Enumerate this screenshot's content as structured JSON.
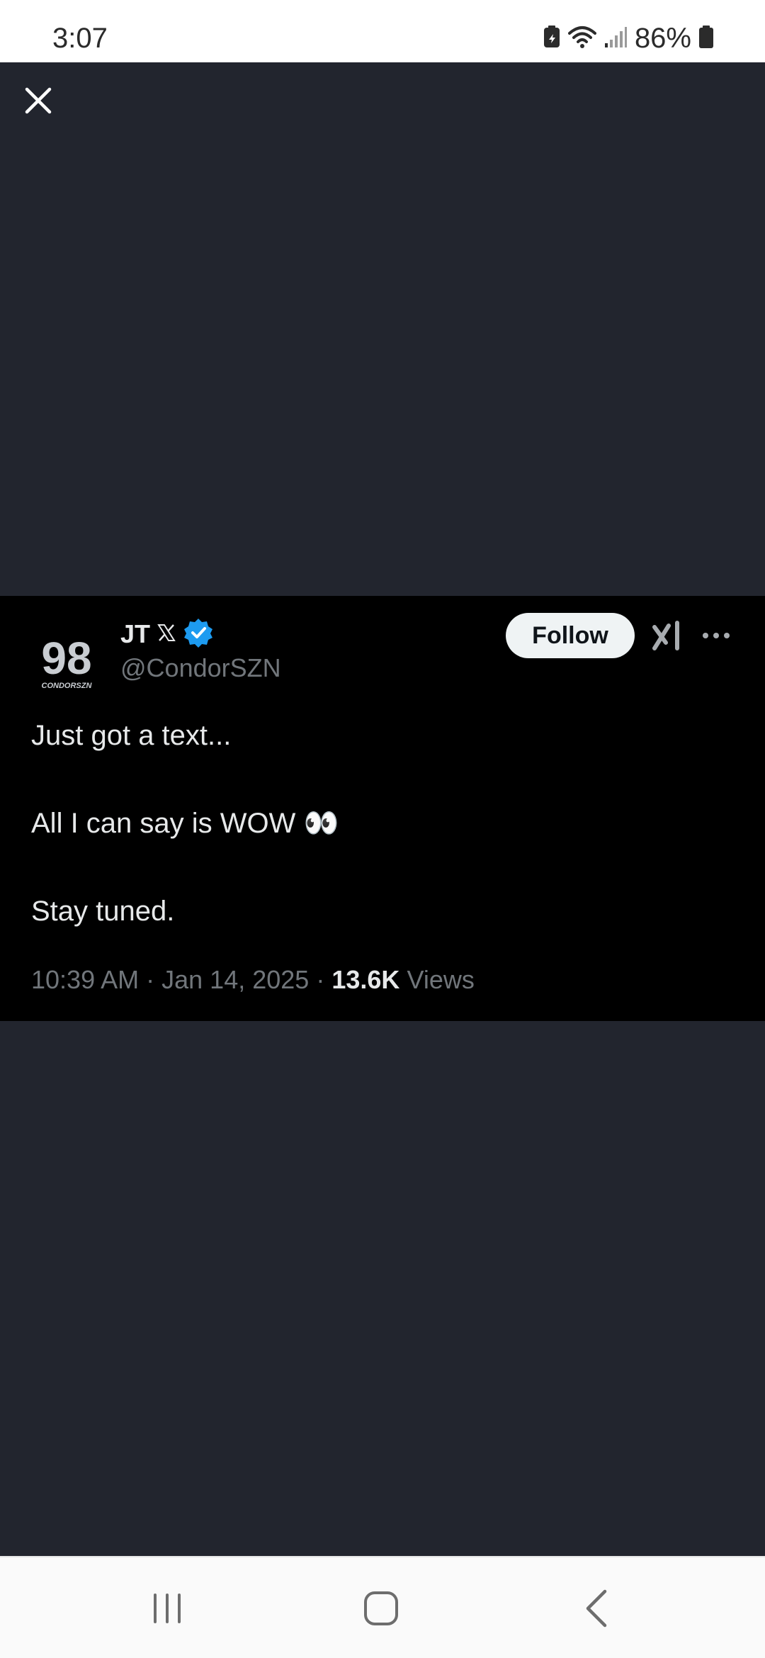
{
  "status_bar": {
    "time": "3:07",
    "battery_percent": "86%",
    "icons": [
      "battery-saver-icon",
      "wifi-icon",
      "cell-signal-icon",
      "battery-icon"
    ]
  },
  "viewer": {
    "close_icon": "close-icon"
  },
  "tweet": {
    "avatar_text": "98",
    "avatar_subtext": "CONDORSZN",
    "display_name": "JT",
    "name_badges": [
      "x-logo-icon",
      "verified-badge-icon"
    ],
    "handle": "@CondorSZN",
    "follow_label": "Follow",
    "grok_icon": "grok-icon",
    "more_icon": "more-options-icon",
    "text_lines": [
      "Just got a text...",
      "",
      "All I can say is WOW 👀",
      "",
      "Stay tuned."
    ],
    "line1": "Just got a text...",
    "line2": "All I can say is WOW 👀",
    "line3": "Stay tuned.",
    "time": "10:39 AM",
    "date": "Jan 14, 2025",
    "views_count": "13.6K",
    "views_label": "Views",
    "separator": "·"
  },
  "nav_bar": {
    "items": [
      "recents-icon",
      "home-icon",
      "back-icon"
    ]
  },
  "colors": {
    "backdrop": "#22252e",
    "card": "#000000",
    "text_primary": "#e7e9ea",
    "text_secondary": "#71767b",
    "verified_blue": "#1d9bf0",
    "follow_bg": "#eff3f4"
  }
}
